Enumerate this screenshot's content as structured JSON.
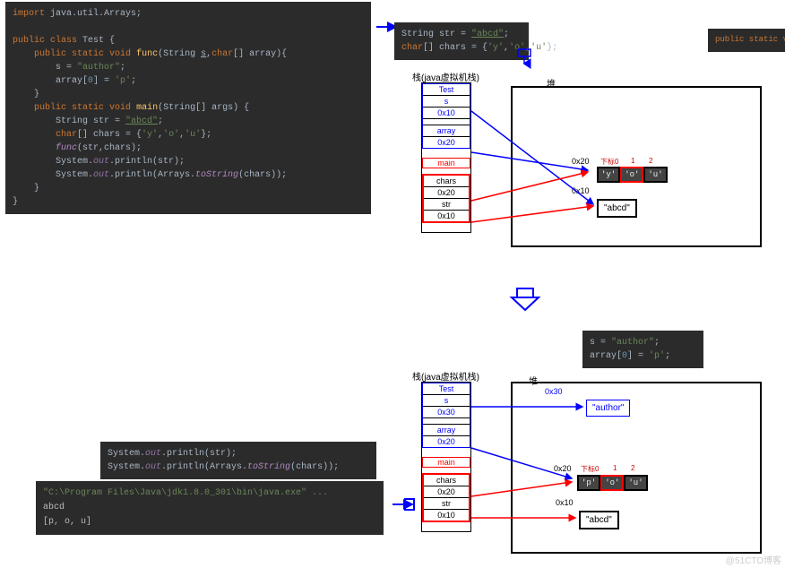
{
  "code_main": {
    "l1": "import java.util.Arrays;",
    "l2": "public class Test {",
    "l3": "    public static void func(String s,char[] array){",
    "l4": "        s = \"author\";",
    "l5": "        array[0] = 'p';",
    "l6": "    }",
    "l7": "    public static void main(String[] args) {",
    "l8": "        String str = \"abcd\";",
    "l9": "        char[] chars = {'y','o','u'};",
    "l10": "        func(str,chars);",
    "l11": "        System.out.println(str);",
    "l12": "        System.out.println(Arrays.toString(chars));",
    "l13": "    }",
    "l14": "}"
  },
  "snippet1": {
    "l1": "String str = \"abcd\";",
    "l2": "char[] chars = {'y','o','u'};"
  },
  "snippet2": {
    "l1": "public static void func(String s,char[] array){"
  },
  "snippet3": {
    "l1": "s = \"author\";",
    "l2": "array[0] = 'p';"
  },
  "print_code": {
    "l1": "System.out.println(str);",
    "l2": "System.out.println(Arrays.toString(chars));"
  },
  "terminal": {
    "cmd": "\"C:\\Program Files\\Java\\jdk1.8.0_301\\bin\\java.exe\" ...",
    "out1": "abcd",
    "out2": "[p, o, u]"
  },
  "stack1": {
    "label": "栈(java虚拟机栈)",
    "heap_label": "堆",
    "frames": {
      "test": "Test",
      "s": "s",
      "s_addr": "0x10",
      "array": "array",
      "array_addr": "0x20",
      "main": "main",
      "chars": "chars",
      "chars_addr": "0x20",
      "str": "str",
      "str_addr": "0x10"
    }
  },
  "heap1": {
    "arr_addr": "0x20",
    "idx_label": "下标0",
    "idx1": "1",
    "idx2": "2",
    "arr": [
      "'y'",
      "'o'",
      "'u'"
    ],
    "str_addr": "0x10",
    "str_val": "\"abcd\""
  },
  "stack2": {
    "label": "栈(java虚拟机栈)",
    "heap_label": "堆"
  },
  "heap2": {
    "author_addr": "0x30",
    "author_val": "\"author\"",
    "arr_addr": "0x20",
    "idx_label": "下标0",
    "idx1": "1",
    "idx2": "2",
    "arr": [
      "'p'",
      "'o'",
      "'u'"
    ],
    "str_addr": "0x10",
    "str_val": "\"abcd\""
  },
  "watermark": "@51CTO博客"
}
